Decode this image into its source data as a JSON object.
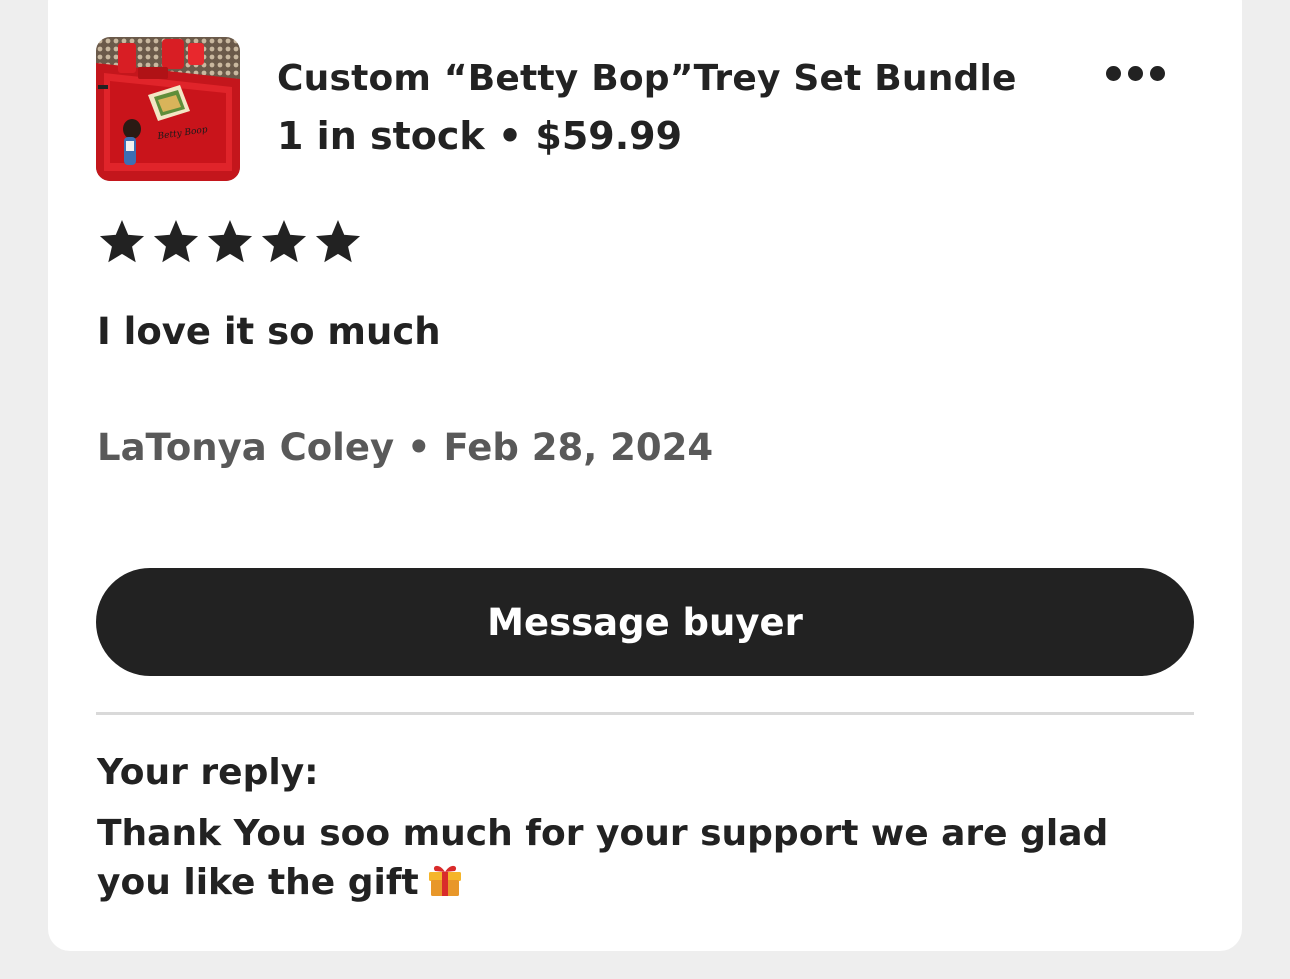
{
  "listing": {
    "title": "Custom “Betty Bop”Trey Set Bundle",
    "stock_price": "1 in stock • $59.99",
    "thumbnail_icon": "product-photo-red-tray"
  },
  "menu": {
    "icon": "more-options-icon"
  },
  "review": {
    "rating": 5,
    "rating_max": 5,
    "text": "I love it so much",
    "meta": "LaTonya Coley • Feb 28, 2024"
  },
  "actions": {
    "message_buyer_label": "Message buyer"
  },
  "reply": {
    "label": "Your reply:",
    "text": "Thank You soo much for your support we are glad you like the gift",
    "trailing_icon": "gift-emoji-icon"
  },
  "colors": {
    "page_background": "#eeeeee",
    "card_background": "#ffffff",
    "text_primary": "#222222",
    "text_secondary": "#595959",
    "button_background": "#222222",
    "button_text": "#ffffff",
    "divider": "#d9d9d9"
  }
}
